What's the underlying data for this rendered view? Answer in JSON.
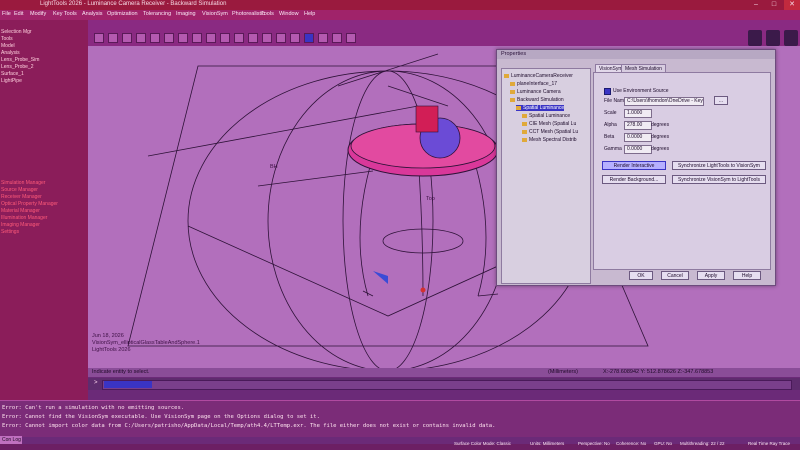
{
  "titlebar": {
    "title": "LightTools 2026 - Luminance Camera Receiver - Backward Simulation",
    "minimize": "–",
    "maximize": "□",
    "close": "✕"
  },
  "menu": [
    "File",
    "Edit",
    "Modify",
    "Key Tools",
    "Analysis",
    "Optimization",
    "Tolerancing",
    "Imaging",
    "VisionSym",
    "Photorealistic",
    "Tools",
    "Window",
    "Help"
  ],
  "left_panel": {
    "top_items": [
      "Selection Mgr",
      "Tools",
      "Model",
      "Analysis",
      "Lens_Probe_Sim",
      "Lens_Probe_2",
      "Surface_1",
      "LightPipe"
    ],
    "mid_items": [
      "Simulation Manager",
      "Source Manager",
      "Receiver Manager",
      "Optical Property Manager",
      "Material Manager",
      "Illumination Manager",
      "Imaging Manager",
      "Settings"
    ]
  },
  "viewport": {
    "info_lines": [
      "Jun 18, 2026",
      "VisionSym_ellipticalGlassTableAndSphere.1",
      "LightTools 2026"
    ],
    "callouts": [
      "BH",
      "Top"
    ]
  },
  "status": {
    "prompt": "Indicate entity to select.",
    "units": "(Millimeters)",
    "coords": "X:-278.608942 Y: 512.878626 Z:-347.678853"
  },
  "command": {
    "marker": ">",
    "value": "Cmd in progress"
  },
  "output": {
    "lines": [
      "Error: Can't run a simulation with no emitting sources.",
      "Error: Cannot find the VisionSym executable.  Use VisionSym page on the Options dialog to set it.",
      "Error: Cannot import color data from C:/Users/patrisho/AppData/Local/Temp/ath4.4/LTTemp.exr. The file either does not exist or contains invalid data."
    ]
  },
  "log_tab": "Con Log",
  "bottom_status": [
    "Surface Color Mode: Classic",
    "Units: Millimeters",
    "Perspective: No",
    "Coherence: No",
    "GPU: No",
    "Multithreading: 22 / 22",
    "Real Time Ray Trace"
  ],
  "dialog": {
    "title": "Properties",
    "tree": [
      {
        "label": "LuminanceCameraReceiver",
        "level": 0
      },
      {
        "label": "planeInterface_17",
        "level": 1
      },
      {
        "label": "Luminance Camera",
        "level": 1
      },
      {
        "label": "Backward Simulation",
        "level": 1
      },
      {
        "label": "Spatial Luminance",
        "level": 2,
        "selected": true
      },
      {
        "label": "Spatial Luminance",
        "level": 3
      },
      {
        "label": "CIE Mesh (Spatial Lu",
        "level": 3
      },
      {
        "label": "CCT Mesh (Spatial Lu",
        "level": 3
      },
      {
        "label": "Mesh Spectral Distrib",
        "level": 3
      }
    ],
    "tabs": [
      "VisionSym",
      "Mesh Simulation"
    ],
    "checkbox": "Use Environment Source",
    "fields": [
      {
        "label": "File Name",
        "value": "C:\\Users\\fhomdon\\OneDrive - Keys",
        "unit": ""
      },
      {
        "label": "Scale",
        "value": "1.0000",
        "unit": ""
      },
      {
        "label": "Alpha",
        "value": "278.00",
        "unit": "degrees"
      },
      {
        "label": "Beta",
        "value": "0.0000",
        "unit": "degrees"
      },
      {
        "label": "Gamma",
        "value": "0.0000",
        "unit": "degrees"
      }
    ],
    "browse": "...",
    "buttons": {
      "render_interactive": "Render Interactive",
      "sync_lighttools": "Synchronize LightTools to VisionSym",
      "render_background": "Render Background...",
      "sync_visionsym": "Synchronize VisionSym to LightTools",
      "ok": "OK",
      "cancel": "Cancel",
      "apply": "Apply",
      "help": "Help"
    }
  }
}
